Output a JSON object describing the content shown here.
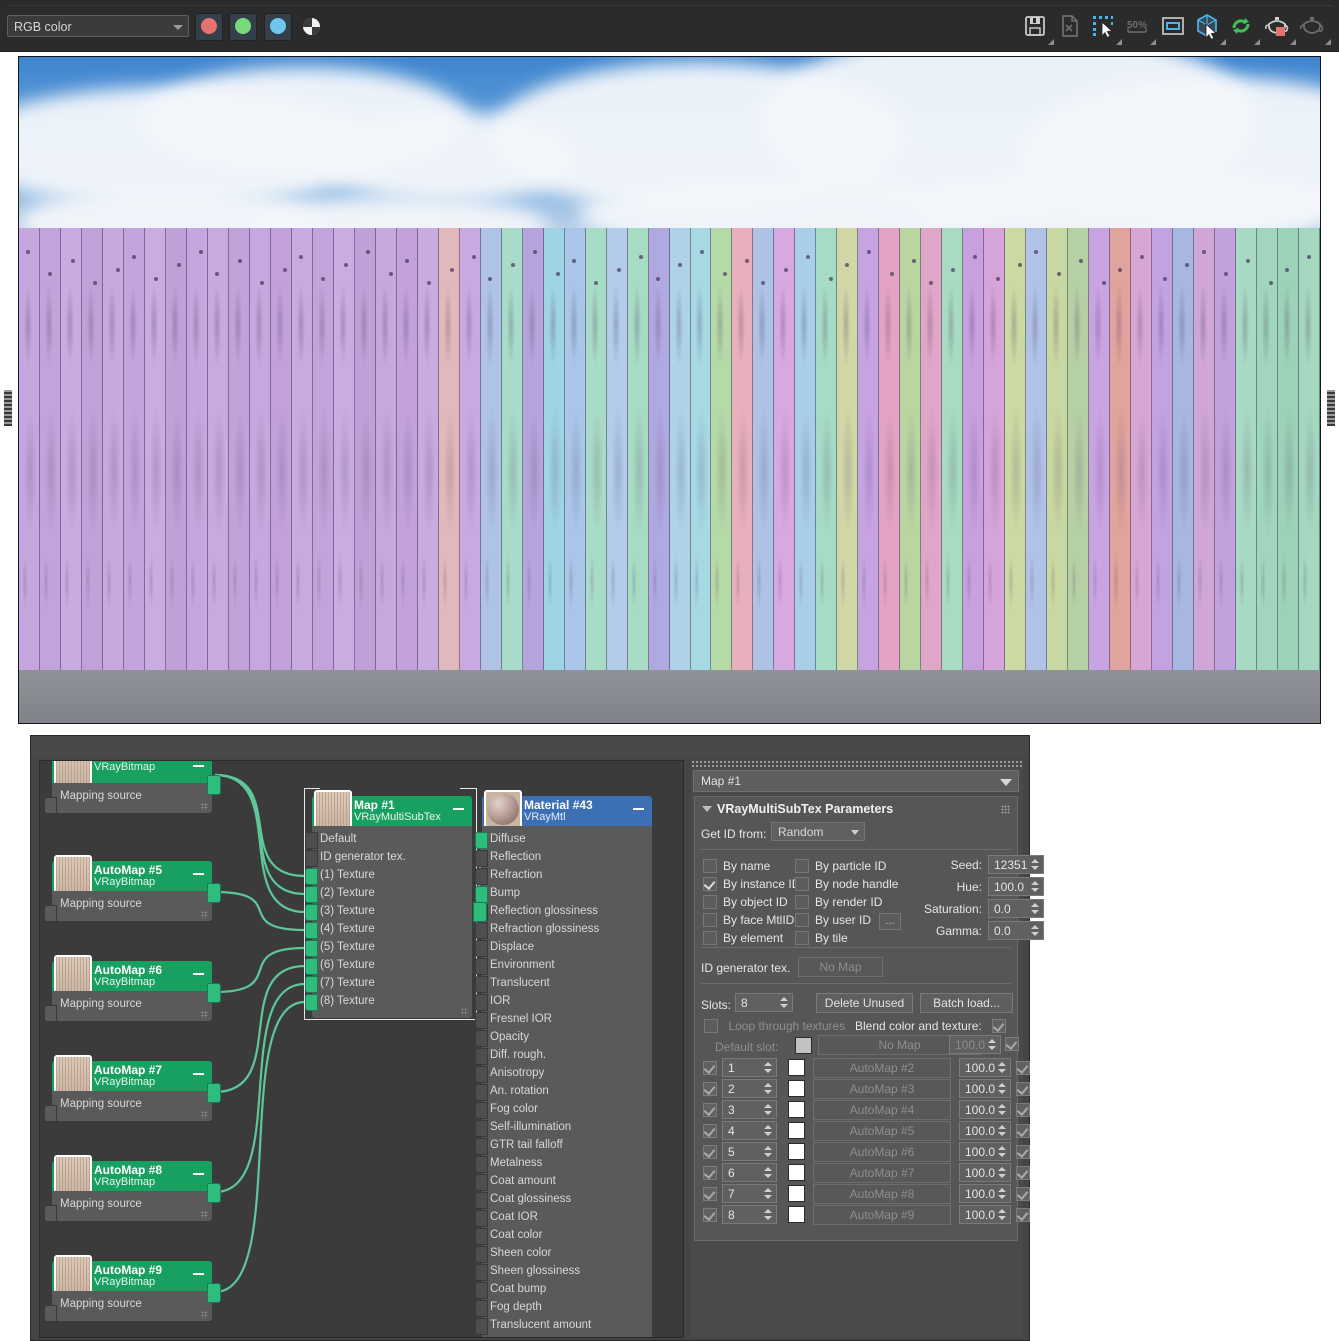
{
  "toolbar": {
    "color_mode": "RGB color",
    "swatches": [
      {
        "name": "red-channel-button",
        "color": "#e8736e"
      },
      {
        "name": "green-channel-button",
        "color": "#79d97b"
      },
      {
        "name": "blue-channel-button",
        "color": "#6fc6ee"
      }
    ],
    "alpha_label": "alpha-toggle",
    "right_icons": [
      {
        "name": "save-bitmap-icon",
        "glyph": "save"
      },
      {
        "name": "clone-rendered-frame-icon",
        "glyph": "page"
      },
      {
        "name": "region-select-icon",
        "glyph": "region"
      },
      {
        "name": "zoom-level-icon",
        "glyph": "50%",
        "text": "50%"
      },
      {
        "name": "toggle-ui-icon",
        "glyph": "window"
      },
      {
        "name": "pick-object-icon",
        "glyph": "cube"
      },
      {
        "name": "refresh-icon",
        "glyph": "refresh"
      },
      {
        "name": "render-teapot-icon",
        "glyph": "teapot-red"
      },
      {
        "name": "teapot-outline-icon",
        "glyph": "teapot"
      }
    ]
  },
  "viewport": {
    "name": "rendered-frame-window",
    "description": "Rendered wooden fence with randomly tinted planks under a cloudy blue sky"
  },
  "node_editor": {
    "title": "slate-material-editor",
    "nodes": [
      {
        "title": "",
        "subtitle": "VRayBitmap",
        "slot_label": "Mapping source",
        "kind": "bitmap",
        "partial": true
      },
      {
        "title": "AutoMap #5",
        "subtitle": "VRayBitmap",
        "slot_label": "Mapping source",
        "kind": "bitmap"
      },
      {
        "title": "AutoMap #6",
        "subtitle": "VRayBitmap",
        "slot_label": "Mapping source",
        "kind": "bitmap"
      },
      {
        "title": "AutoMap #7",
        "subtitle": "VRayBitmap",
        "slot_label": "Mapping source",
        "kind": "bitmap"
      },
      {
        "title": "AutoMap #8",
        "subtitle": "VRayBitmap",
        "slot_label": "Mapping source",
        "kind": "bitmap"
      },
      {
        "title": "AutoMap #9",
        "subtitle": "VRayBitmap",
        "slot_label": "Mapping source",
        "kind": "bitmap"
      }
    ],
    "map_node": {
      "title": "Map #1",
      "subtitle": "VRayMultiSubTex",
      "rows": [
        "Default",
        "ID generator tex.",
        "(1) Texture",
        "(2) Texture",
        "(3) Texture",
        "(4) Texture",
        "(5) Texture",
        "(6) Texture",
        "(7) Texture",
        "(8) Texture"
      ]
    },
    "material_node": {
      "title": "Material #43",
      "subtitle": "VRayMtl",
      "rows": [
        "Diffuse",
        "Reflection",
        "Refraction",
        "Bump",
        "Reflection glossiness",
        "Refraction glossiness",
        "Displace",
        "Environment",
        "Translucent",
        "IOR",
        "Fresnel IOR",
        "Opacity",
        "Diff. rough.",
        "Anisotropy",
        "An. rotation",
        "Fog color",
        "Self-illumination",
        "GTR tail falloff",
        "Metalness",
        "Coat amount",
        "Coat glossiness",
        "Coat IOR",
        "Coat color",
        "Sheen color",
        "Sheen glossiness",
        "Coat bump",
        "Fog depth",
        "Translucent amount"
      ]
    }
  },
  "panel": {
    "selected_map": "Map #1",
    "rollout_title": "VRayMultiSubTex Parameters",
    "get_id_from_label": "Get ID from:",
    "get_id_from_value": "Random",
    "id_options": {
      "col1": [
        {
          "label": "By name",
          "checked": false
        },
        {
          "label": "By instance ID",
          "checked": true
        },
        {
          "label": "By object ID",
          "checked": false
        },
        {
          "label": "By face MtlID",
          "checked": false
        },
        {
          "label": "By element",
          "checked": false
        }
      ],
      "col2": [
        {
          "label": "By particle ID",
          "checked": false
        },
        {
          "label": "By node handle",
          "checked": false
        },
        {
          "label": "By render ID",
          "checked": false
        },
        {
          "label": "By user ID",
          "checked": false,
          "ellipsis": "..."
        },
        {
          "label": "By tile",
          "checked": false
        }
      ]
    },
    "numeric": [
      {
        "label": "Seed:",
        "value": "12351"
      },
      {
        "label": "Hue:",
        "value": "100.0"
      },
      {
        "label": "Saturation:",
        "value": "0.0"
      },
      {
        "label": "Gamma:",
        "value": "0.0"
      }
    ],
    "id_generator_tex_label": "ID generator tex.",
    "id_generator_tex_value": "No Map",
    "slots_label": "Slots:",
    "slots_count": "8",
    "delete_unused_label": "Delete Unused",
    "batch_load_label": "Batch load...",
    "loop_through_textures_label": "Loop through textures",
    "loop_through_textures_checked": false,
    "blend_color_and_texture_label": "Blend color and texture:",
    "blend_color_and_texture_checked": true,
    "default_slot_label": "Default slot:",
    "default_slot_map": "No Map",
    "default_slot_amount": "100.0",
    "default_slot_enabled": true,
    "slot_rows": [
      {
        "enabled": true,
        "id": "1",
        "map": "AutoMap #2",
        "amount": "100.0",
        "on": true
      },
      {
        "enabled": true,
        "id": "2",
        "map": "AutoMap #3",
        "amount": "100.0",
        "on": true
      },
      {
        "enabled": true,
        "id": "3",
        "map": "AutoMap #4",
        "amount": "100.0",
        "on": true
      },
      {
        "enabled": true,
        "id": "4",
        "map": "AutoMap #5",
        "amount": "100.0",
        "on": true
      },
      {
        "enabled": true,
        "id": "5",
        "map": "AutoMap #6",
        "amount": "100.0",
        "on": true
      },
      {
        "enabled": true,
        "id": "6",
        "map": "AutoMap #7",
        "amount": "100.0",
        "on": true
      },
      {
        "enabled": true,
        "id": "7",
        "map": "AutoMap #8",
        "amount": "100.0",
        "on": true
      },
      {
        "enabled": true,
        "id": "8",
        "map": "AutoMap #9",
        "amount": "100.0",
        "on": true
      }
    ]
  },
  "colors": {
    "node_map_header": "#17a05f",
    "node_mtl_header": "#3d6fb5",
    "wire": "#5ec79a",
    "panel_bg": "#4a4a4a",
    "canvas_bg": "#3b3b3b"
  }
}
